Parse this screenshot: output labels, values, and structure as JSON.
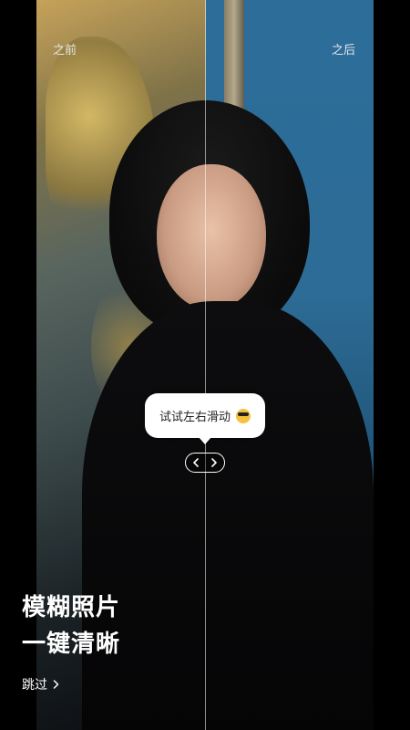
{
  "comparison": {
    "before_label": "之前",
    "after_label": "之后"
  },
  "hint": {
    "text": "试试左右滑动",
    "emoji_icon": "sunglasses-emoji-icon"
  },
  "slider": {
    "left_icon": "chevron-left-icon",
    "right_icon": "chevron-right-icon",
    "position": 0.5
  },
  "headline": {
    "line1": "模糊照片",
    "line2": "一键清晰"
  },
  "skip": {
    "label": "跳过",
    "icon": "chevron-right-icon"
  },
  "colors": {
    "background": "#000000",
    "text": "#ffffff",
    "bubble": "#ffffff"
  }
}
